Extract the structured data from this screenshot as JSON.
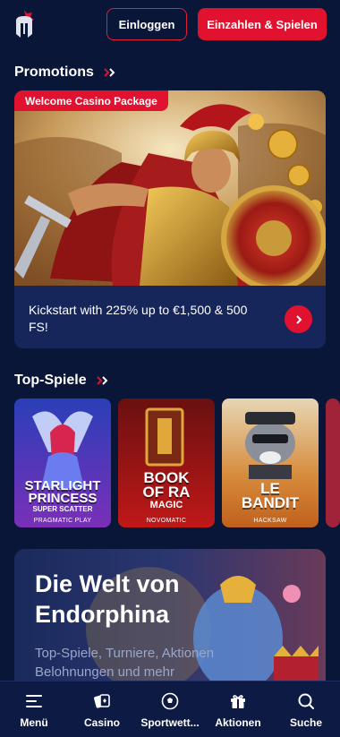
{
  "header": {
    "login_label": "Einloggen",
    "deposit_label": "Einzahlen & Spielen"
  },
  "promotions": {
    "title": "Promotions",
    "card": {
      "tag": "Welcome Casino Package",
      "text": "Kickstart with 225% up to €1,500 & 500 FS!"
    }
  },
  "top_games": {
    "title": "Top-Spiele",
    "items": [
      {
        "title_line1": "STARLIGHT",
        "title_line2": "PRINCESS",
        "subtitle": "SUPER SCATTER",
        "provider": "PRAGMATIC PLAY"
      },
      {
        "title_line1": "BOOK",
        "title_line2": "OF RA",
        "subtitle": "MAGIC",
        "provider": "NOVOMATIC"
      },
      {
        "title_line1": "LE",
        "title_line2": "BANDIT",
        "subtitle": "",
        "provider": "HACKSAW"
      }
    ]
  },
  "banner": {
    "title": "Die Welt von Endorphina",
    "text": "Top-Spiele, Turniere, Aktionen Belohnungen und mehr"
  },
  "bottom_nav": {
    "items": [
      {
        "label": "Menü",
        "icon": "menu-icon"
      },
      {
        "label": "Casino",
        "icon": "cards-icon"
      },
      {
        "label": "Sportwett...",
        "icon": "soccer-ball-icon"
      },
      {
        "label": "Aktionen",
        "icon": "gift-icon"
      },
      {
        "label": "Suche",
        "icon": "search-icon"
      }
    ]
  },
  "colors": {
    "background": "#0a1637",
    "accent": "#e1122f",
    "card": "#16255a"
  }
}
